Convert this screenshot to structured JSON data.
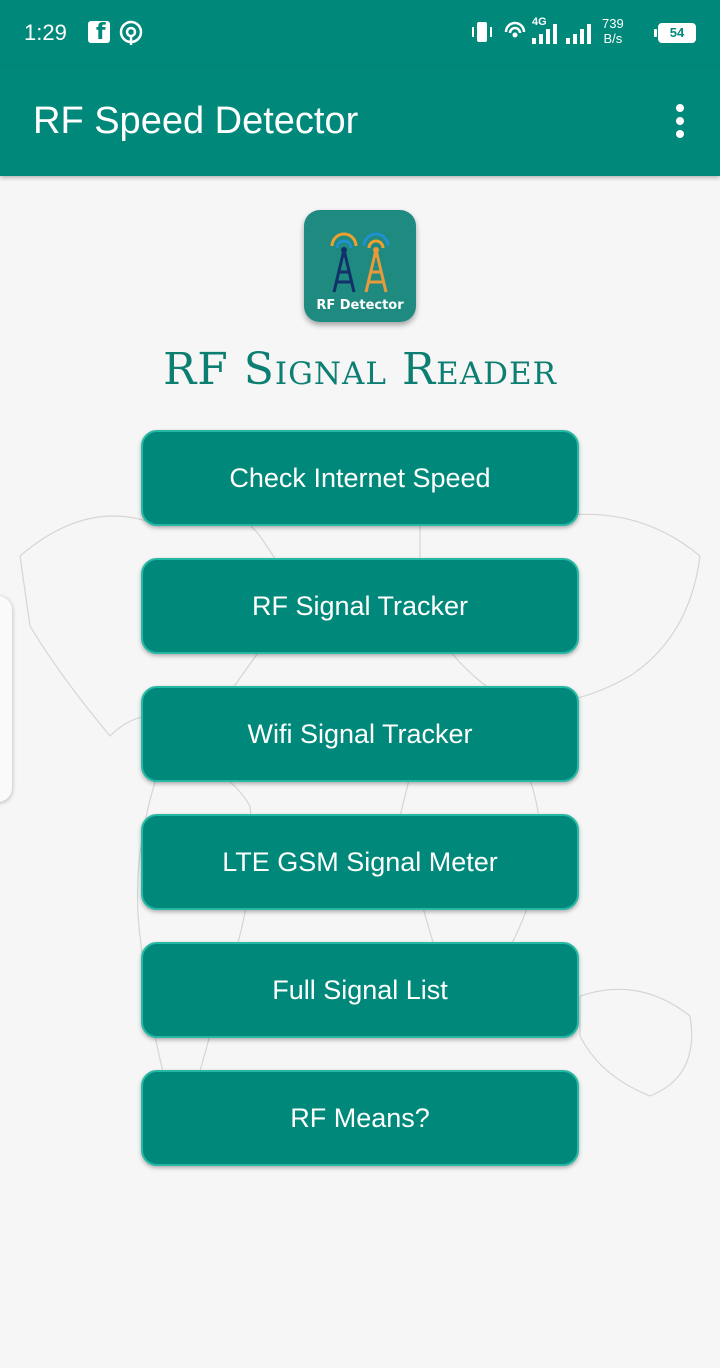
{
  "status_bar": {
    "time": "1:29",
    "network_type": "4G",
    "speed_value": "739",
    "speed_unit": "B/s",
    "battery": "54",
    "icons": [
      "facebook-icon",
      "hotspot-icon",
      "vibrate-icon",
      "wifi-call-icon",
      "signal-icon",
      "battery-icon"
    ]
  },
  "app_bar": {
    "title": "RF Speed Detector",
    "menu_icon": "more-vert-icon"
  },
  "logo": {
    "label": "RF Detector"
  },
  "heading": "RF Signal Reader",
  "buttons": [
    {
      "label": "Check Internet Speed"
    },
    {
      "label": "RF Signal Tracker"
    },
    {
      "label": "Wifi Signal Tracker"
    },
    {
      "label": "LTE GSM Signal Meter"
    },
    {
      "label": "Full Signal List"
    },
    {
      "label": "RF Means?"
    }
  ],
  "colors": {
    "primary": "#00897b",
    "button_border": "#26b8a4",
    "heading": "#0c7f72",
    "background": "#f6f6f6"
  }
}
